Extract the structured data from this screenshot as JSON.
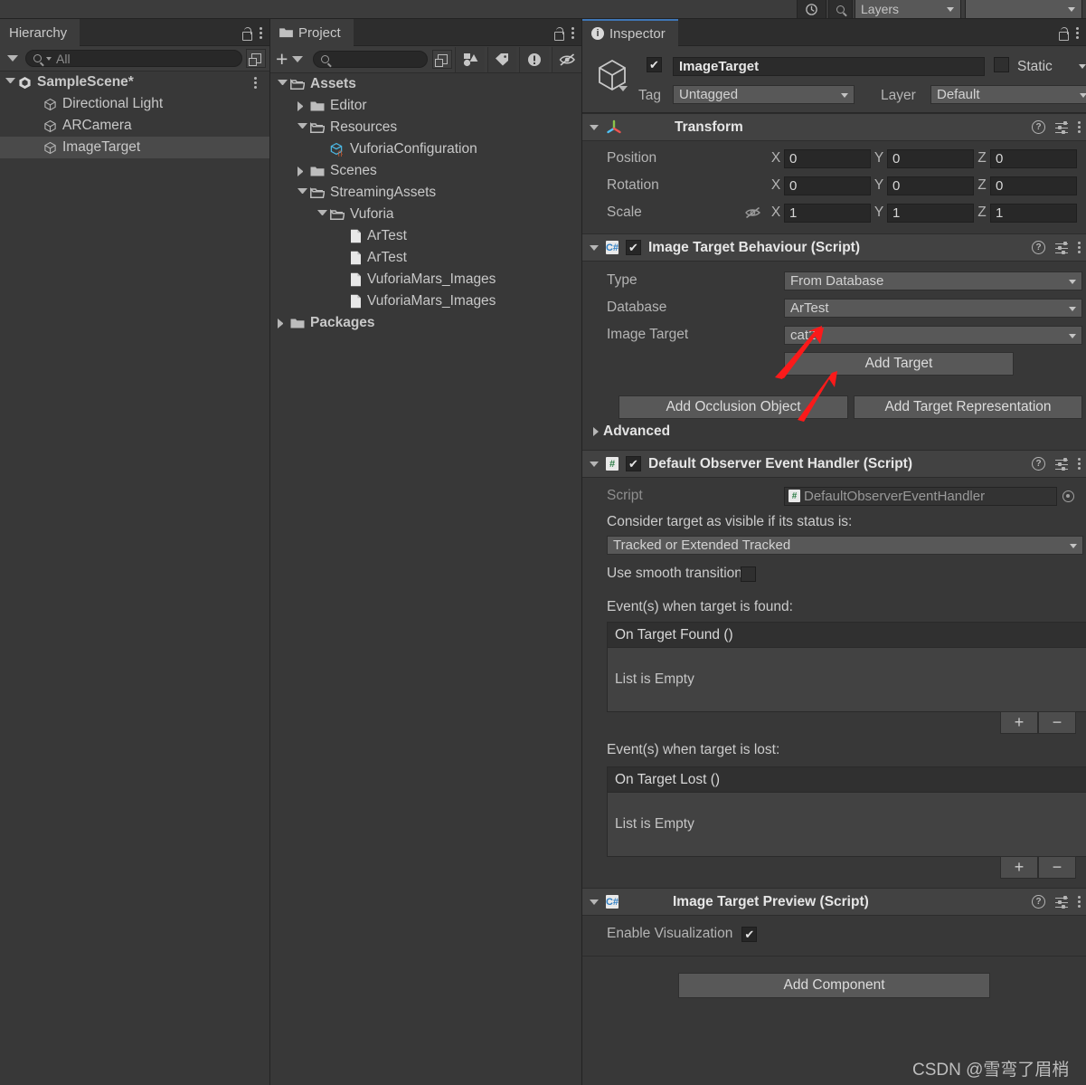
{
  "top_toolbar": {
    "layers_dropdown": "Layers",
    "layout_dropdown": "",
    "search_icon": "search-icon",
    "account_icon": "cloud-icon"
  },
  "hierarchy": {
    "tab_label": "Hierarchy",
    "tab_icon": "hierarchy-icon",
    "search_placeholder": "All",
    "search_value": "",
    "items": [
      {
        "label": "SampleScene*",
        "icon": "unity-scene-icon",
        "depth": 0,
        "expanded": true,
        "bold": true,
        "selected": false
      },
      {
        "label": "Directional Light",
        "icon": "gameobject-cube-icon",
        "depth": 1,
        "bold": false,
        "selected": false
      },
      {
        "label": "ARCamera",
        "icon": "gameobject-cube-icon",
        "depth": 1,
        "bold": false,
        "selected": false
      },
      {
        "label": "ImageTarget",
        "icon": "gameobject-cube-icon",
        "depth": 1,
        "bold": false,
        "selected": true
      }
    ]
  },
  "project": {
    "tab_label": "Project",
    "tab_icon": "folder-icon",
    "search_placeholder": "",
    "search_value": "",
    "toolbar_icons": [
      "create-plus-icon",
      "search-icon",
      "save-search-icon",
      "type-filter-icon",
      "label-filter-icon",
      "warning-filter-icon",
      "hidden-eye-icon"
    ],
    "items": [
      {
        "label": "Assets",
        "icon": "folder-open-icon",
        "depth": 0,
        "twirl": "down",
        "bold": true
      },
      {
        "label": "Editor",
        "icon": "folder-icon",
        "depth": 1,
        "twirl": "right",
        "bold": false
      },
      {
        "label": "Resources",
        "icon": "folder-open-icon",
        "depth": 1,
        "twirl": "down",
        "bold": false
      },
      {
        "label": "VuforiaConfiguration",
        "icon": "scriptable-object-icon",
        "depth": 2,
        "twirl": "none",
        "bold": false
      },
      {
        "label": "Scenes",
        "icon": "folder-icon",
        "depth": 1,
        "twirl": "right",
        "bold": false
      },
      {
        "label": "StreamingAssets",
        "icon": "folder-open-icon",
        "depth": 1,
        "twirl": "down",
        "bold": false
      },
      {
        "label": "Vuforia",
        "icon": "folder-open-icon",
        "depth": 2,
        "twirl": "down",
        "bold": false
      },
      {
        "label": "ArTest",
        "icon": "file-icon",
        "depth": 3,
        "twirl": "none",
        "bold": false
      },
      {
        "label": "ArTest",
        "icon": "file-icon",
        "depth": 3,
        "twirl": "none",
        "bold": false
      },
      {
        "label": "VuforiaMars_Images",
        "icon": "file-icon",
        "depth": 3,
        "twirl": "none",
        "bold": false
      },
      {
        "label": "VuforiaMars_Images",
        "icon": "file-icon",
        "depth": 3,
        "twirl": "none",
        "bold": false
      },
      {
        "label": "Packages",
        "icon": "folder-icon",
        "depth": 0,
        "twirl": "right",
        "bold": true
      }
    ]
  },
  "inspector": {
    "tab_label": "Inspector",
    "tab_icon": "info-icon",
    "accent_color": "#3f76b5",
    "gameobject": {
      "enabled": true,
      "name": "ImageTarget",
      "static_label": "Static",
      "static_checked": false,
      "tag_label": "Tag",
      "tag_value": "Untagged",
      "layer_label": "Layer",
      "layer_value": "Default"
    },
    "transform": {
      "title": "Transform",
      "expanded": true,
      "position_label": "Position",
      "rotation_label": "Rotation",
      "scale_label": "Scale",
      "axes": [
        "X",
        "Y",
        "Z"
      ],
      "position": [
        "0",
        "0",
        "0"
      ],
      "rotation": [
        "0",
        "0",
        "0"
      ],
      "scale": [
        "1",
        "1",
        "1"
      ],
      "scale_lock_icon": "constrained-proportions-off-icon"
    },
    "image_target_behaviour": {
      "title": "Image Target Behaviour (Script)",
      "enabled": true,
      "expanded": true,
      "icon": "cs-script-icon",
      "type_label": "Type",
      "type_value": "From Database",
      "database_label": "Database",
      "database_value": "ArTest",
      "image_target_label": "Image Target",
      "image_target_value": "cat2",
      "add_target_button": "Add Target",
      "add_occlusion_button": "Add Occlusion Object",
      "add_representation_button": "Add Target Representation",
      "advanced_label": "Advanced",
      "advanced_expanded": false
    },
    "observer_event_handler": {
      "title": "Default Observer Event Handler (Script)",
      "enabled": true,
      "expanded": true,
      "icon": "cs-script-icon",
      "script_label": "Script",
      "script_value": "DefaultObserverEventHandler",
      "status_label": "Consider target as visible if its status is:",
      "status_value": "Tracked or Extended Tracked",
      "smooth_transition_label": "Use smooth transition",
      "smooth_transition_checked": false,
      "found_section_label": "Event(s) when target is found:",
      "found_event_name": "On Target Found ()",
      "found_empty_text": "List is Empty",
      "lost_section_label": "Event(s) when target is lost:",
      "lost_event_name": "On Target Lost ()",
      "lost_empty_text": "List is Empty",
      "add_button": "+",
      "remove_button": "−"
    },
    "image_target_preview": {
      "title": "Image Target Preview (Script)",
      "expanded": true,
      "icon": "cs-script-icon",
      "enable_visualization_label": "Enable Visualization",
      "enable_visualization_checked": true
    },
    "add_component_button": "Add Component"
  },
  "annotations": {
    "arrow_color": "#fb1a1a",
    "arrow_count": 2
  },
  "watermark": {
    "text": "CSDN @雪弯了眉梢"
  }
}
